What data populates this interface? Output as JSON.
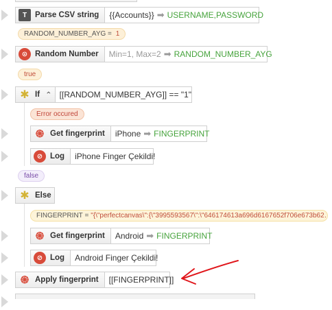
{
  "rows": {
    "parse_csv": {
      "action": "Parse CSV string",
      "param": "{{Accounts}}",
      "output": "USERNAME,PASSWORD"
    },
    "random_var_pill": {
      "name": "RANDOM_NUMBER_AYG",
      "value": "1"
    },
    "random_number": {
      "action": "Random Number",
      "param": "Min=1, Max=2",
      "output": "RANDOM_NUMBER_AYG"
    },
    "true_pill": "true",
    "if_block": {
      "action": "If",
      "condition": "[[RANDOM_NUMBER_AYG]] == \"1\""
    },
    "error_pill": "Error occured",
    "get_fp_iphone": {
      "action": "Get fingerprint",
      "param": "iPhone",
      "output": "FINGERPRINT"
    },
    "log_iphone": {
      "action": "Log",
      "param": "iPhone Finger Çekildi!"
    },
    "false_pill": "false",
    "else_block": {
      "action": "Else"
    },
    "fingerprint_pill": {
      "name": "FINGERPRINT",
      "value": "\"{\\\"perfectcanvas\\\":{\\\"3995593567\\\":\\\"646174613a696d6167652f706e673b62…"
    },
    "get_fp_android": {
      "action": "Get fingerprint",
      "param": "Android",
      "output": "FINGERPRINT"
    },
    "log_android": {
      "action": "Log",
      "param": "Android Finger Çekildi!"
    },
    "apply_fp": {
      "action": "Apply fingerprint",
      "param": "[[FINGERPRINT]]"
    }
  },
  "icons": {
    "csv": "text-t-icon",
    "random": "dice-icon",
    "if": "puzzle-icon",
    "fingerprint": "fingerprint-icon",
    "log": "log-icon"
  },
  "colors": {
    "output_green": "#46a33c",
    "annotation_red": "#e0161b",
    "icon_red": "#d84b3a",
    "if_yellow": "#d3b336"
  }
}
